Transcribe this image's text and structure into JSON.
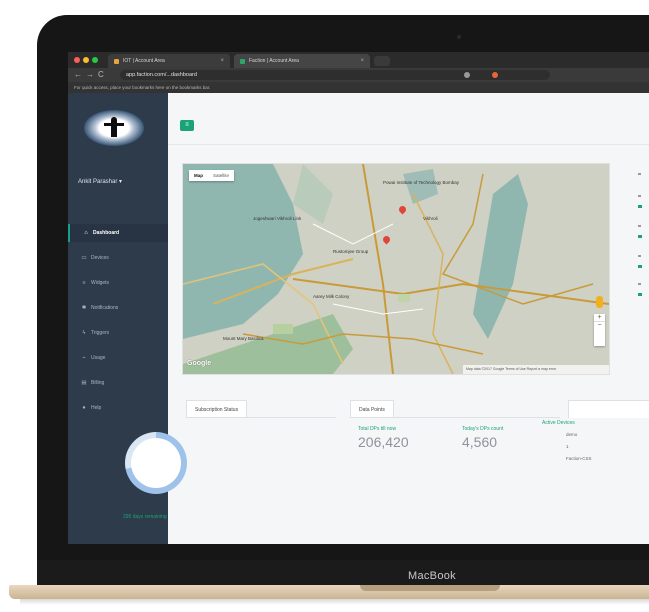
{
  "device": {
    "brand_label": "MacBook"
  },
  "browser": {
    "tabs": [
      {
        "title": "IOT | Account Area",
        "favicon_color": "#e8a33a"
      },
      {
        "title": "Faction | Account Area",
        "favicon_color": "#2aa86a"
      }
    ],
    "url": "app.faction.com/...dashboard",
    "bookmarks_hint": "For quick access, place your bookmarks here on the bookmarks bar."
  },
  "sidebar": {
    "user_name": "Ankit Parashar ▾",
    "items": [
      {
        "label": "Dashboard",
        "icon": "home-icon",
        "glyph": "⌂",
        "active": true
      },
      {
        "label": "Devices",
        "icon": "monitor-icon",
        "glyph": "▭",
        "active": false
      },
      {
        "label": "Widgets",
        "icon": "sliders-icon",
        "glyph": "≡",
        "active": false
      },
      {
        "label": "Notifications",
        "icon": "bell-icon",
        "glyph": "✱",
        "active": false
      },
      {
        "label": "Triggers",
        "icon": "bolt-icon",
        "glyph": "ϟ",
        "active": false
      },
      {
        "label": "Usage",
        "icon": "chart-icon",
        "glyph": "⌁",
        "active": false
      },
      {
        "label": "Billing",
        "icon": "card-icon",
        "glyph": "▤",
        "active": false
      },
      {
        "label": "Help",
        "icon": "question-icon",
        "glyph": "●",
        "active": false
      }
    ]
  },
  "main": {
    "add_button_glyph": "≡",
    "map": {
      "toggle": [
        "Map",
        "Satellite"
      ],
      "labels": [
        "Powai Institute of Technology Bombay",
        "Vikhroli",
        "Jogeshwari Vikhroli Link",
        "Aarey Milk Colony",
        "Rustomjee Group",
        "Mount Mary Basilica"
      ],
      "google_label": "Google",
      "footer_text": "Map data ©2017 Google  Terms of Use  Report a map error"
    },
    "subscription": {
      "tab_label": "Subscription Status",
      "progress": 0.72,
      "days_remaining": "295 days remaining"
    },
    "data_points": {
      "tab_label": "Data Points",
      "total_label": "Total DPs till now",
      "total_value": "206,420",
      "today_label": "Today's DPs count",
      "today_value": "4,560"
    },
    "active_devices": {
      "tab_label": "Active Devices",
      "items": [
        "demo",
        "1",
        "Faction-CSS"
      ]
    }
  },
  "colors": {
    "accent": "#1aa374",
    "sidebar": "#2e3b4b",
    "ring": "#9ec2ea"
  }
}
